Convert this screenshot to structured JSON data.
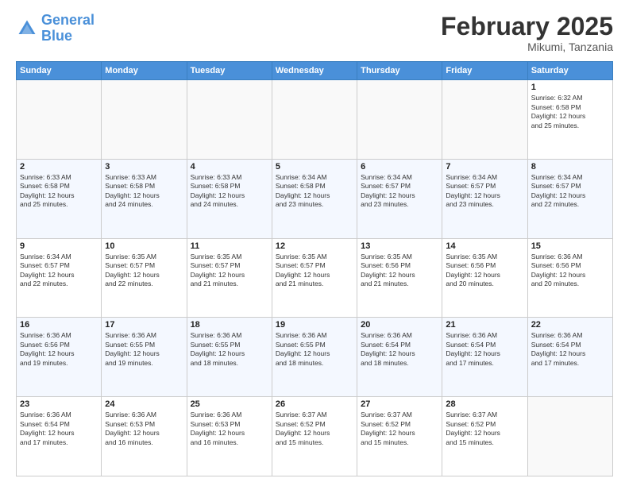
{
  "header": {
    "logo_general": "General",
    "logo_blue": "Blue",
    "month_title": "February 2025",
    "location": "Mikumi, Tanzania"
  },
  "days_of_week": [
    "Sunday",
    "Monday",
    "Tuesday",
    "Wednesday",
    "Thursday",
    "Friday",
    "Saturday"
  ],
  "weeks": [
    [
      {
        "day": "",
        "info": ""
      },
      {
        "day": "",
        "info": ""
      },
      {
        "day": "",
        "info": ""
      },
      {
        "day": "",
        "info": ""
      },
      {
        "day": "",
        "info": ""
      },
      {
        "day": "",
        "info": ""
      },
      {
        "day": "1",
        "info": "Sunrise: 6:32 AM\nSunset: 6:58 PM\nDaylight: 12 hours\nand 25 minutes."
      }
    ],
    [
      {
        "day": "2",
        "info": "Sunrise: 6:33 AM\nSunset: 6:58 PM\nDaylight: 12 hours\nand 25 minutes."
      },
      {
        "day": "3",
        "info": "Sunrise: 6:33 AM\nSunset: 6:58 PM\nDaylight: 12 hours\nand 24 minutes."
      },
      {
        "day": "4",
        "info": "Sunrise: 6:33 AM\nSunset: 6:58 PM\nDaylight: 12 hours\nand 24 minutes."
      },
      {
        "day": "5",
        "info": "Sunrise: 6:34 AM\nSunset: 6:58 PM\nDaylight: 12 hours\nand 23 minutes."
      },
      {
        "day": "6",
        "info": "Sunrise: 6:34 AM\nSunset: 6:57 PM\nDaylight: 12 hours\nand 23 minutes."
      },
      {
        "day": "7",
        "info": "Sunrise: 6:34 AM\nSunset: 6:57 PM\nDaylight: 12 hours\nand 23 minutes."
      },
      {
        "day": "8",
        "info": "Sunrise: 6:34 AM\nSunset: 6:57 PM\nDaylight: 12 hours\nand 22 minutes."
      }
    ],
    [
      {
        "day": "9",
        "info": "Sunrise: 6:34 AM\nSunset: 6:57 PM\nDaylight: 12 hours\nand 22 minutes."
      },
      {
        "day": "10",
        "info": "Sunrise: 6:35 AM\nSunset: 6:57 PM\nDaylight: 12 hours\nand 22 minutes."
      },
      {
        "day": "11",
        "info": "Sunrise: 6:35 AM\nSunset: 6:57 PM\nDaylight: 12 hours\nand 21 minutes."
      },
      {
        "day": "12",
        "info": "Sunrise: 6:35 AM\nSunset: 6:57 PM\nDaylight: 12 hours\nand 21 minutes."
      },
      {
        "day": "13",
        "info": "Sunrise: 6:35 AM\nSunset: 6:56 PM\nDaylight: 12 hours\nand 21 minutes."
      },
      {
        "day": "14",
        "info": "Sunrise: 6:35 AM\nSunset: 6:56 PM\nDaylight: 12 hours\nand 20 minutes."
      },
      {
        "day": "15",
        "info": "Sunrise: 6:36 AM\nSunset: 6:56 PM\nDaylight: 12 hours\nand 20 minutes."
      }
    ],
    [
      {
        "day": "16",
        "info": "Sunrise: 6:36 AM\nSunset: 6:56 PM\nDaylight: 12 hours\nand 19 minutes."
      },
      {
        "day": "17",
        "info": "Sunrise: 6:36 AM\nSunset: 6:55 PM\nDaylight: 12 hours\nand 19 minutes."
      },
      {
        "day": "18",
        "info": "Sunrise: 6:36 AM\nSunset: 6:55 PM\nDaylight: 12 hours\nand 18 minutes."
      },
      {
        "day": "19",
        "info": "Sunrise: 6:36 AM\nSunset: 6:55 PM\nDaylight: 12 hours\nand 18 minutes."
      },
      {
        "day": "20",
        "info": "Sunrise: 6:36 AM\nSunset: 6:54 PM\nDaylight: 12 hours\nand 18 minutes."
      },
      {
        "day": "21",
        "info": "Sunrise: 6:36 AM\nSunset: 6:54 PM\nDaylight: 12 hours\nand 17 minutes."
      },
      {
        "day": "22",
        "info": "Sunrise: 6:36 AM\nSunset: 6:54 PM\nDaylight: 12 hours\nand 17 minutes."
      }
    ],
    [
      {
        "day": "23",
        "info": "Sunrise: 6:36 AM\nSunset: 6:54 PM\nDaylight: 12 hours\nand 17 minutes."
      },
      {
        "day": "24",
        "info": "Sunrise: 6:36 AM\nSunset: 6:53 PM\nDaylight: 12 hours\nand 16 minutes."
      },
      {
        "day": "25",
        "info": "Sunrise: 6:36 AM\nSunset: 6:53 PM\nDaylight: 12 hours\nand 16 minutes."
      },
      {
        "day": "26",
        "info": "Sunrise: 6:37 AM\nSunset: 6:52 PM\nDaylight: 12 hours\nand 15 minutes."
      },
      {
        "day": "27",
        "info": "Sunrise: 6:37 AM\nSunset: 6:52 PM\nDaylight: 12 hours\nand 15 minutes."
      },
      {
        "day": "28",
        "info": "Sunrise: 6:37 AM\nSunset: 6:52 PM\nDaylight: 12 hours\nand 15 minutes."
      },
      {
        "day": "",
        "info": ""
      }
    ]
  ]
}
